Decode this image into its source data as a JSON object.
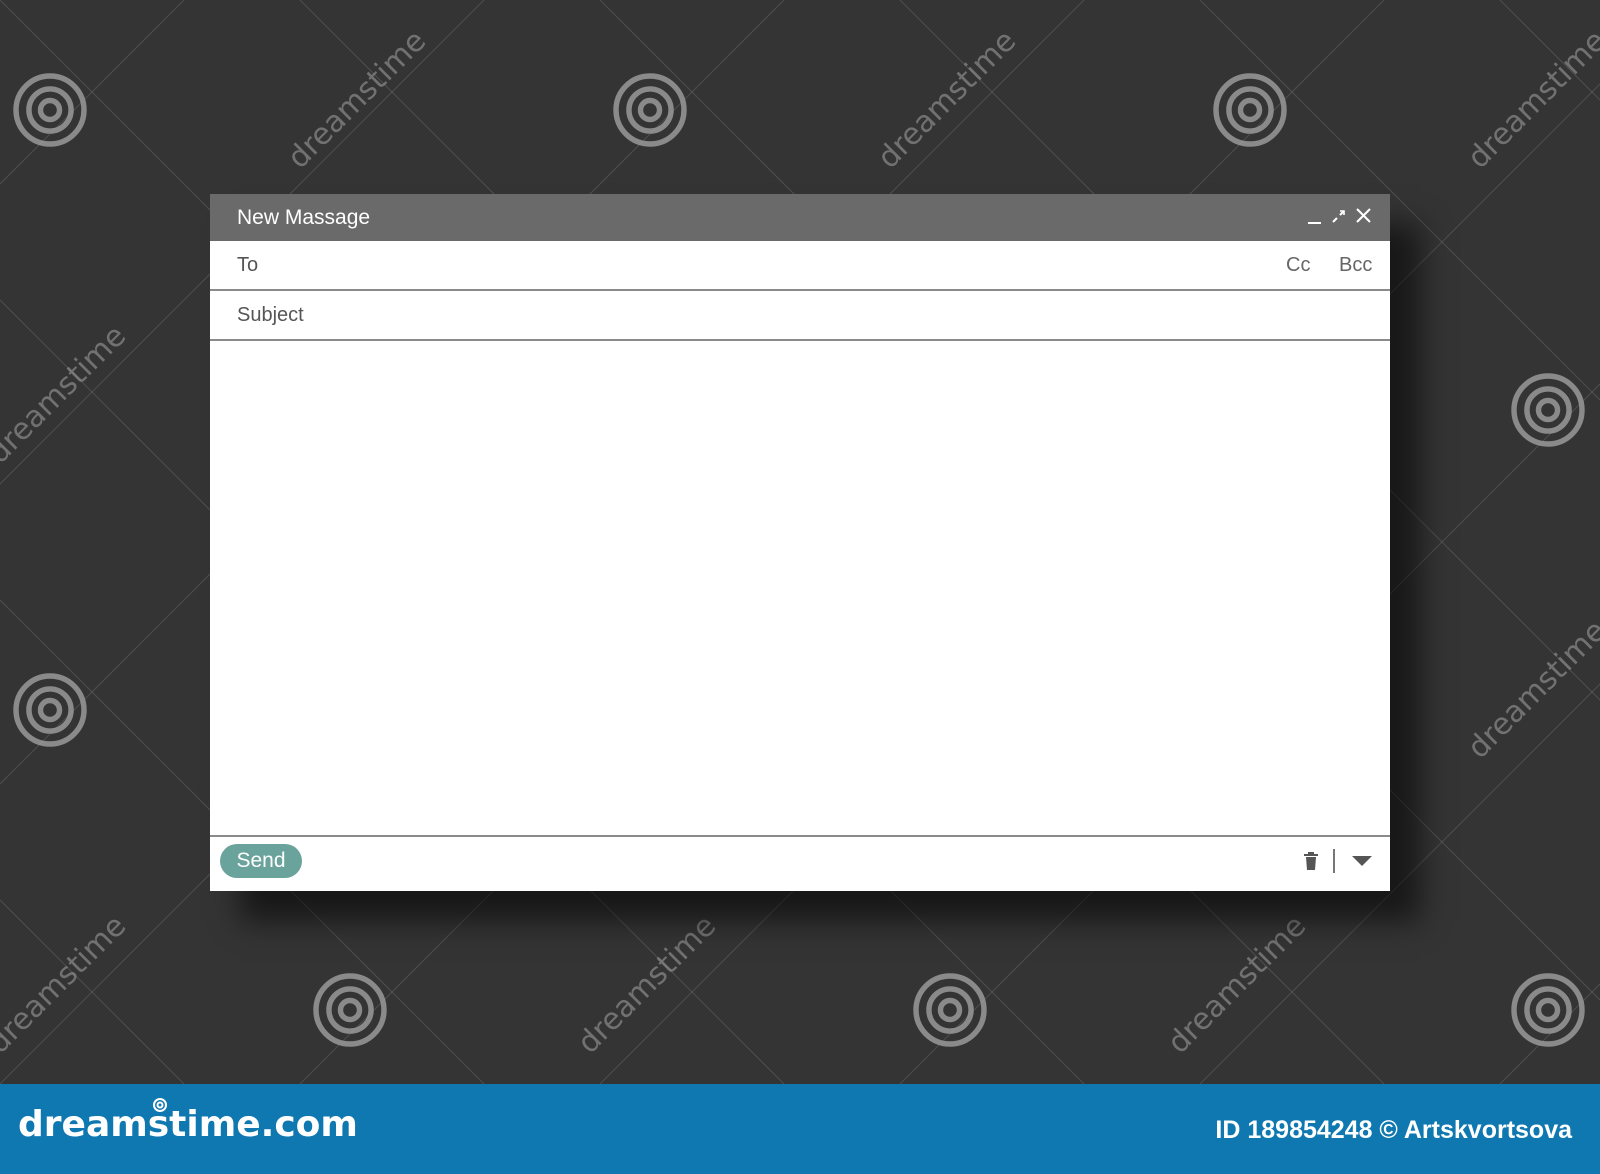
{
  "window": {
    "title": "New Massage"
  },
  "fields": {
    "to_label": "To",
    "cc_label": "Cc",
    "bcc_label": "Bcc",
    "subject_label": "Subject"
  },
  "toolbar": {
    "send_label": "Send"
  },
  "icons": {
    "minimize": "minimize-icon",
    "expand": "expand-icon",
    "close": "close-icon",
    "trash": "trash-icon",
    "more": "chevron-down-icon"
  },
  "colors": {
    "background": "#343434",
    "titlebar": "#6a6a6a",
    "send_button": "#6aa39c",
    "footer": "#0f78b0"
  },
  "watermark": {
    "text": "dreamstime",
    "footer_site": "dreamstime.com",
    "footer_credit": "ID 189854248 © Artskvortsova"
  }
}
